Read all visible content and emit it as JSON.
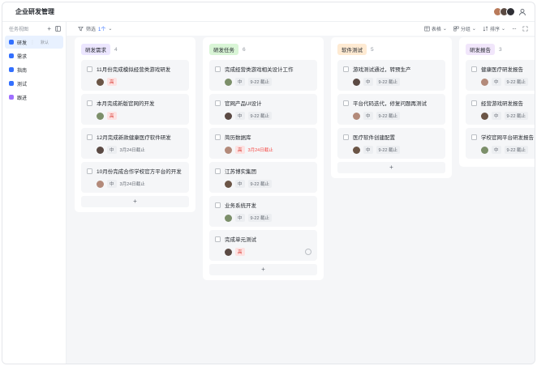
{
  "header": {
    "title": "企业研发管理"
  },
  "sidebar": {
    "title": "任务视图",
    "items": [
      {
        "label": "研发",
        "tag": "默认",
        "color": "#3370ff",
        "active": true
      },
      {
        "label": "需求",
        "color": "#3370ff"
      },
      {
        "label": "指南",
        "color": "#3370ff"
      },
      {
        "label": "测试",
        "color": "#3370ff"
      },
      {
        "label": "跟进",
        "color": "#9f6fff"
      }
    ]
  },
  "toolbar": {
    "filter_label": "筛选",
    "filter_count": "1个",
    "view_label": "表格",
    "group_label": "分组",
    "sort_label": "排序"
  },
  "columns": [
    {
      "label": "研发需求",
      "count": "4",
      "color": "#ece6ff",
      "cards": [
        {
          "title": "11月份完成模拟经营类游戏研发",
          "priority": "高"
        },
        {
          "title": "本月完成新版官网的开发",
          "priority": "高"
        },
        {
          "title": "12月完成新款健康医疗软件研发",
          "priority": "中",
          "due": "3月24日截止"
        },
        {
          "title": "10月份完成合作学校官方平台的开发",
          "priority": "中",
          "due": "3月24日截止"
        }
      ]
    },
    {
      "label": "研发任务",
      "count": "6",
      "color": "#d9f5d6",
      "cards": [
        {
          "title": "完成经营类游戏相关设计工作",
          "priority": "中",
          "due": "9-22 截止"
        },
        {
          "title": "官网产品UI设计",
          "priority": "中",
          "due": "9-22 截止"
        },
        {
          "title": "简历数据库",
          "priority": "高",
          "due": "3月24日截止"
        },
        {
          "title": "江苏博实集团",
          "priority": "中",
          "due": "9-22 截止"
        },
        {
          "title": "业务系统开发",
          "priority": "中",
          "due": "9-22 截止"
        },
        {
          "title": "完成单元测试",
          "priority": "高"
        }
      ]
    },
    {
      "label": "软件测试",
      "count": "5",
      "color": "#feead2",
      "cards": [
        {
          "title": "游戏测试通过，转预生产",
          "priority": "中",
          "due": "9-22 截止"
        },
        {
          "title": "平台代码迭代，修复问题再测试",
          "priority": "中",
          "due": "9-22 截止"
        },
        {
          "title": "医疗软件创建配置",
          "priority": "中",
          "due": "9-22 截止"
        }
      ]
    },
    {
      "label": "研发报告",
      "count": "3",
      "color": "#f1e6fb",
      "cards": [
        {
          "title": "健康医疗研发报告",
          "priority": "中",
          "due": "9-22 截止"
        },
        {
          "title": "经营游戏研发报告",
          "priority": "中",
          "due": "9-22 截止"
        },
        {
          "title": "学校官网平台研发报告",
          "priority": "中",
          "due": "9-22 截止"
        }
      ]
    }
  ],
  "add_symbol": "+"
}
